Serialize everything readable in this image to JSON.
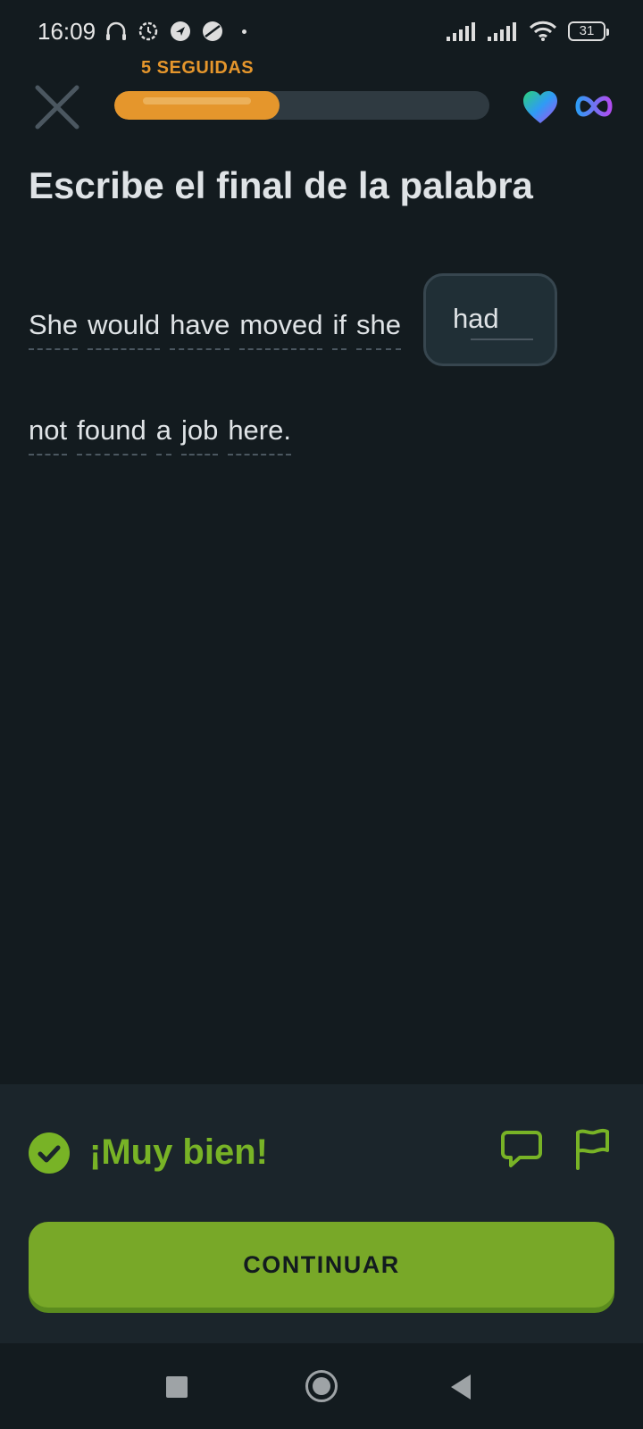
{
  "status_bar": {
    "time": "16:09",
    "battery": "31",
    "icons": [
      "headphones-icon",
      "settings-sync-icon",
      "navigation-icon",
      "planet-icon",
      "signal-icon",
      "signal-icon",
      "wifi-icon",
      "battery-icon"
    ]
  },
  "header": {
    "streak_label": "5 SEGUIDAS",
    "progress": 0.44,
    "accent_color": "#e5962c"
  },
  "title": "Escribe el final de la palabra",
  "sentence": {
    "line1_words": [
      "She",
      "would",
      "have",
      "moved",
      "if",
      "she"
    ],
    "answer": "had",
    "line2_words": [
      "not",
      "found",
      "a",
      "job",
      "here."
    ]
  },
  "feedback": {
    "message": "¡Muy bien!",
    "button_label": "CONTINUAR",
    "success_color": "#78b326"
  }
}
